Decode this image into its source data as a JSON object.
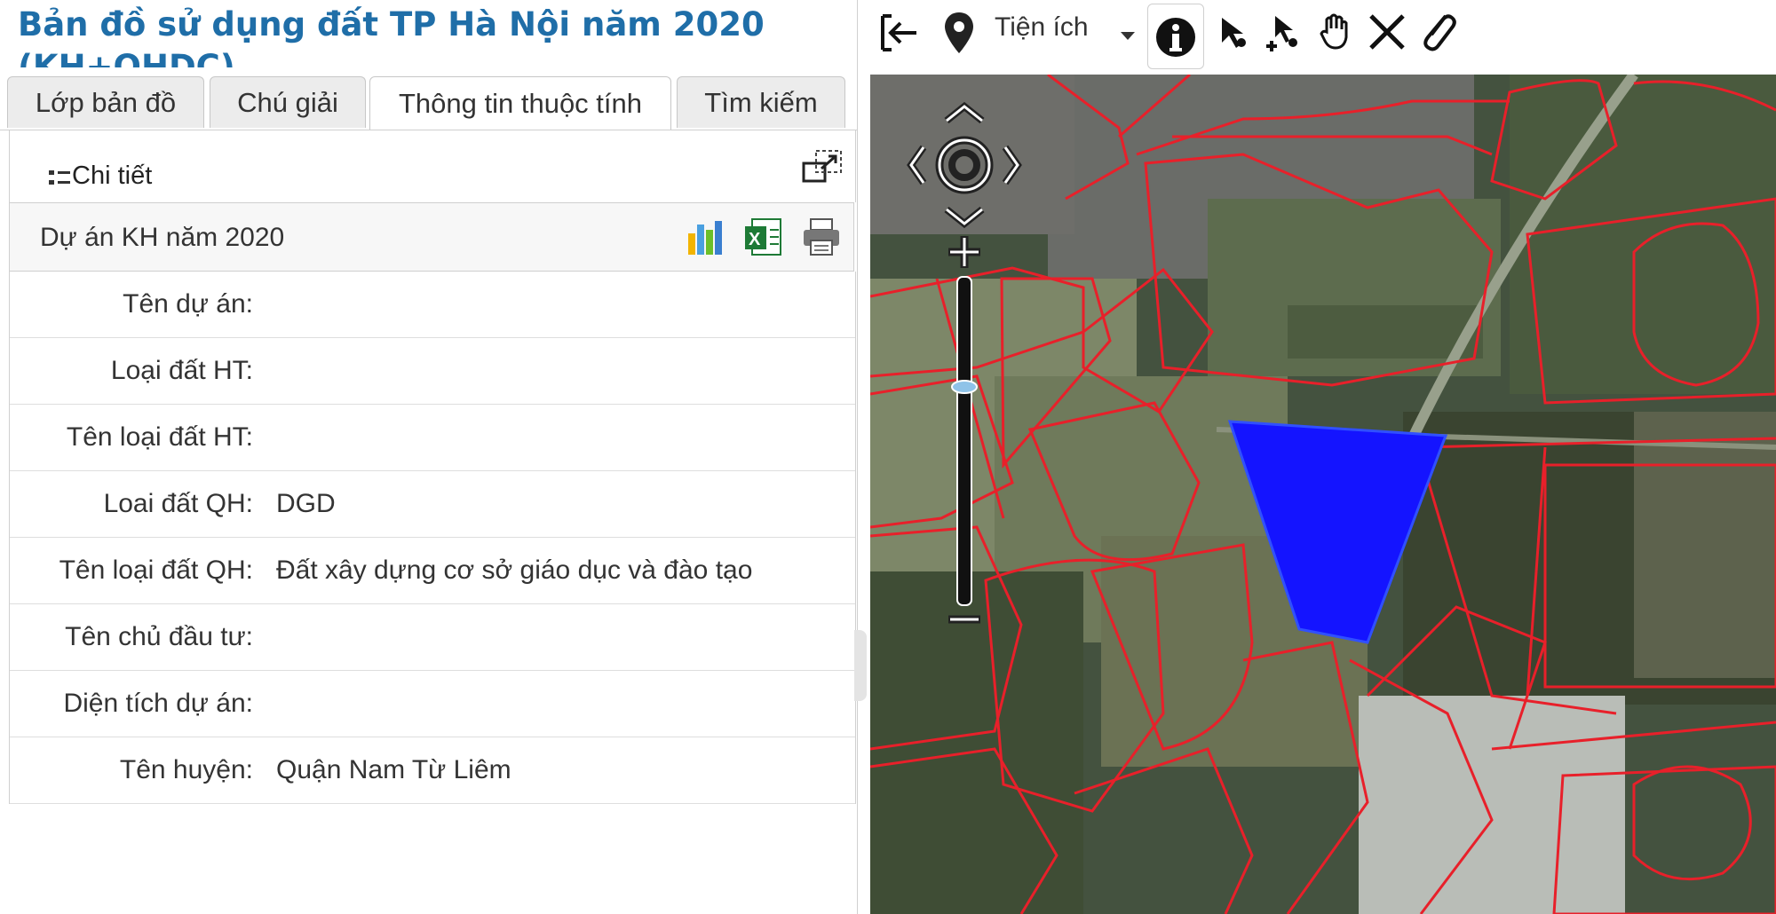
{
  "app": {
    "title_line1": "Bản đồ sử dụng đất TP Hà Nội năm 2020",
    "title_line2": "(KH+QHDC)"
  },
  "tabs": [
    {
      "label": "Lớp bản đồ"
    },
    {
      "label": "Chú giải"
    },
    {
      "label": "Thông tin thuộc tính"
    },
    {
      "label": "Tìm kiếm"
    }
  ],
  "detail": {
    "label": "Chi tiết"
  },
  "project": {
    "title": "Dự án KH năm 2020"
  },
  "attributes": [
    {
      "label": "Tên dự án:",
      "value": ""
    },
    {
      "label": "Loại đất HT:",
      "value": ""
    },
    {
      "label": "Tên loại đất HT:",
      "value": ""
    },
    {
      "label": "Loai đất QH:",
      "value": "DGD"
    },
    {
      "label": "Tên loại đất QH:",
      "value": "Đất xây dựng cơ sở giáo dục và đào tạo"
    },
    {
      "label": "Tên chủ đầu tư:",
      "value": ""
    },
    {
      "label": "Diện tích dự án:",
      "value": ""
    },
    {
      "label": "Tên huyện:",
      "value": "Quận Nam Từ Liêm"
    }
  ],
  "toolbar": {
    "tienich_label": "Tiện ích"
  },
  "icons": {
    "exit": "exit-icon",
    "location": "location-pin-icon",
    "info": "info-icon",
    "select": "select-arrow-icon",
    "select_add": "select-add-icon",
    "pan": "hand-icon",
    "clear": "close-icon",
    "attach": "paperclip-icon"
  },
  "colors": {
    "title": "#1f6ea8",
    "parcel_line": "#e8202a",
    "selected_parcel": "#1414ff"
  }
}
